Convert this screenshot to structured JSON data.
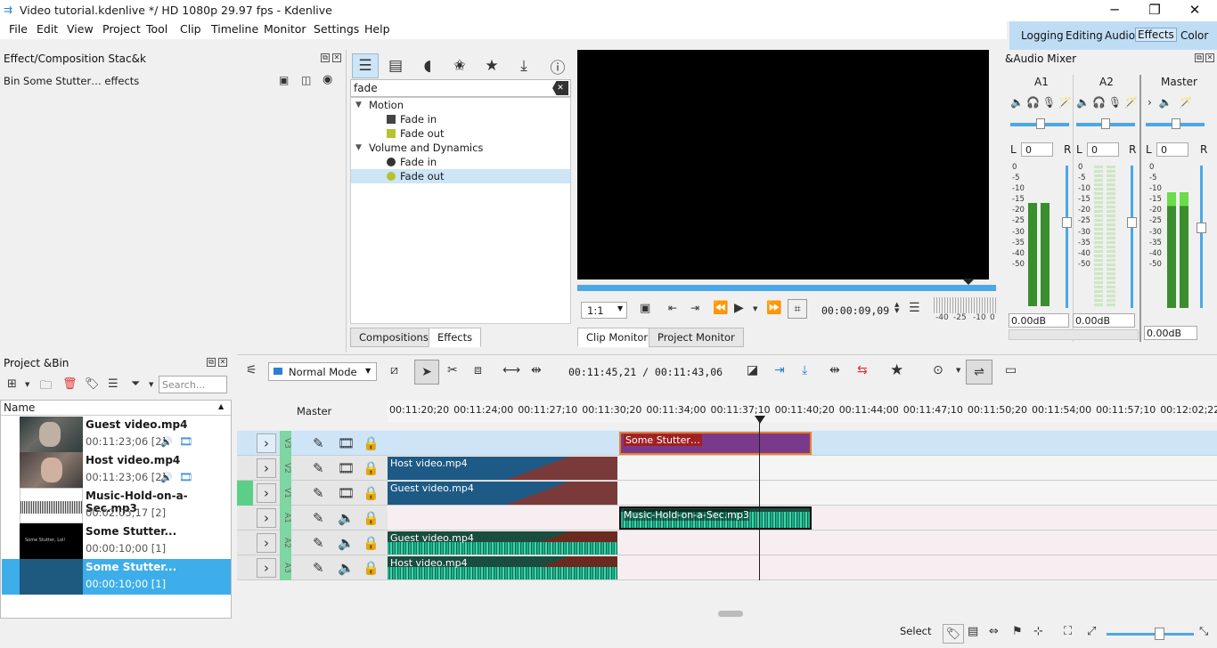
{
  "window": {
    "title": "Video tutorial.kdenlive */ HD 1080p 29.97 fps - Kdenlive"
  },
  "menu": [
    "File",
    "Edit",
    "View",
    "Project",
    "Tool",
    "Clip",
    "Timeline",
    "Monitor",
    "Settings",
    "Help"
  ],
  "layouts": [
    "Logging",
    "Editing",
    "Audio",
    "Effects",
    "Color"
  ],
  "active_layout": "Effects",
  "effect_stack": {
    "title": "Effect/Composition Stac&k",
    "subtitle": "Bin Some Stutter… effects"
  },
  "effects": {
    "search": "fade",
    "groups": [
      {
        "name": "Motion",
        "items": [
          "Fade in",
          "Fade out"
        ]
      },
      {
        "name": "Volume and Dynamics",
        "items": [
          "Fade in",
          "Fade out"
        ]
      }
    ],
    "tabs": [
      "Compositions",
      "Effects"
    ]
  },
  "monitor": {
    "zoom": "1:1",
    "timecode": "00:00:09,09",
    "tabs": [
      "Clip Monitor",
      "Project Monitor"
    ],
    "scale": [
      "-40",
      "-25",
      "-10",
      "0"
    ]
  },
  "mixer": {
    "title": "&Audio Mixer",
    "channels": [
      "A1",
      "A2",
      "Master"
    ],
    "L": "L",
    "R": "R",
    "vol": [
      "0",
      "0",
      "0"
    ],
    "db": [
      "0.00dB",
      "0.00dB",
      "0.00dB"
    ],
    "scale": [
      "0",
      "-5",
      "-10",
      "-15",
      "-20",
      "-25",
      "-30",
      "-35",
      "-40",
      "-50"
    ]
  },
  "bin": {
    "title": "Project &Bin",
    "search_placeholder": "Search...",
    "column": "Name",
    "items": [
      {
        "name": "Guest video.mp4",
        "meta": "00:11:23;06 [2]"
      },
      {
        "name": "Host video.mp4",
        "meta": "00:11:23;06 [2]"
      },
      {
        "name": "Music-Hold-on-a-Sec.mp3",
        "meta": "00:02:05;17 [2]"
      },
      {
        "name": "Some Stutter...",
        "meta": "00:00:10;00 [1]",
        "thumb_text": "Some Stutter, Lol!"
      },
      {
        "name": "Some Stutter...",
        "meta": "00:00:10;00 [1]"
      }
    ]
  },
  "timeline": {
    "mode": "Normal Mode",
    "position": "00:11:45,21 / 00:11:43,06",
    "master": "Master",
    "ruler": [
      "00:11:20;20",
      "00:11:24;00",
      "00:11:27;10",
      "00:11:30;20",
      "00:11:34;00",
      "00:11:37;10",
      "00:11:40;20",
      "00:11:44;00",
      "00:11:47;10",
      "00:11:50;20",
      "00:11:54;00",
      "00:11:57;10",
      "00:12:02;22"
    ],
    "tracks": [
      "V3",
      "V2",
      "V1",
      "A1",
      "A2",
      "A3"
    ],
    "clips": {
      "v3": "Some Stutter…",
      "v2": "Host video.mp4",
      "v1": "Guest video.mp4",
      "a1": "Music-Hold-on-a-Sec.mp3",
      "a2": "Guest video.mp4",
      "a3": "Host video.mp4"
    }
  },
  "status": {
    "mode": "Select"
  },
  "colors": {
    "accent": "#3daee9",
    "video_clip": "#1d5a85",
    "title_clip": "#7a3a8c",
    "audio_clip": "#1a4d3f",
    "mixer_meter": "#3a8e2e"
  }
}
